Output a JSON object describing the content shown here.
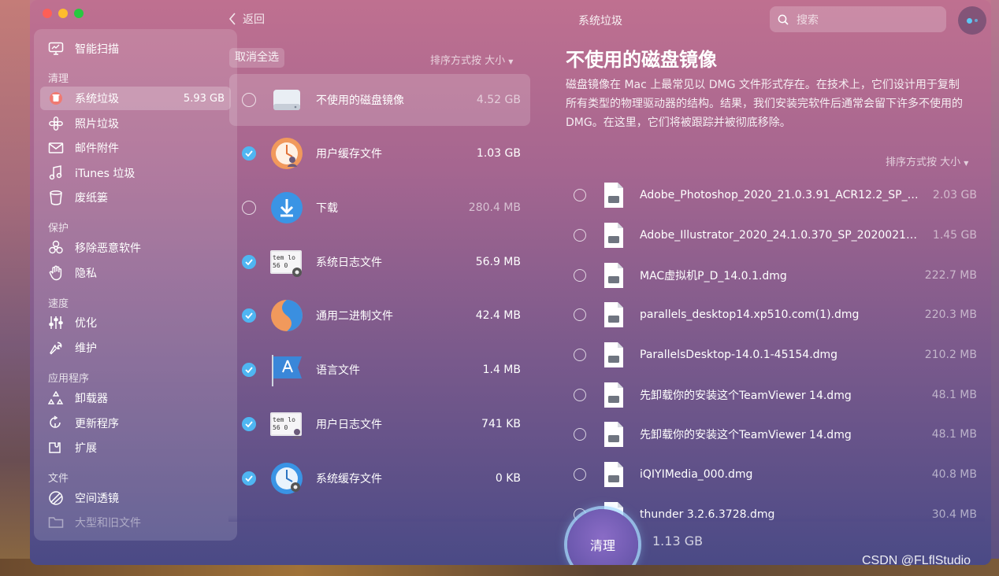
{
  "window": {
    "title": "系统垃圾",
    "back_label": "返回",
    "search_placeholder": "搜索"
  },
  "sidebar": {
    "top_item": {
      "label": "智能扫描",
      "icon": "monitor-icon"
    },
    "sections": [
      {
        "title": "清理",
        "items": [
          {
            "label": "系统垃圾",
            "value": "5.93 GB",
            "active": true,
            "icon": "trash-can-icon"
          },
          {
            "label": "照片垃圾",
            "icon": "flower-icon"
          },
          {
            "label": "邮件附件",
            "icon": "mail-icon"
          },
          {
            "label": "iTunes 垃圾",
            "icon": "music-note-icon"
          },
          {
            "label": "废纸篓",
            "icon": "bin-icon"
          }
        ]
      },
      {
        "title": "保护",
        "items": [
          {
            "label": "移除恶意软件",
            "icon": "biohazard-icon"
          },
          {
            "label": "隐私",
            "icon": "hand-icon"
          }
        ]
      },
      {
        "title": "速度",
        "items": [
          {
            "label": "优化",
            "icon": "sliders-icon"
          },
          {
            "label": "维护",
            "icon": "wrench-icon"
          }
        ]
      },
      {
        "title": "应用程序",
        "items": [
          {
            "label": "卸载器",
            "icon": "uninstaller-icon"
          },
          {
            "label": "更新程序",
            "icon": "update-icon"
          },
          {
            "label": "扩展",
            "icon": "extension-icon"
          }
        ]
      },
      {
        "title": "文件",
        "items": [
          {
            "label": "空间透镜",
            "icon": "lens-icon"
          },
          {
            "label": "大型和旧文件",
            "icon": "folder-icon",
            "dim": true
          }
        ]
      }
    ]
  },
  "list": {
    "deselect_label": "取消全选",
    "sort_label": "排序方式按 大小",
    "items": [
      {
        "name": "不使用的磁盘镜像",
        "size": "4.52 GB",
        "checked": false,
        "selected": true,
        "icon": "disk-image-icon"
      },
      {
        "name": "用户缓存文件",
        "size": "1.03 GB",
        "checked": true,
        "icon": "user-cache-icon"
      },
      {
        "name": "下载",
        "size": "280.4 MB",
        "checked": false,
        "icon": "download-icon"
      },
      {
        "name": "系统日志文件",
        "size": "56.9 MB",
        "checked": true,
        "icon": "system-log-icon"
      },
      {
        "name": "通用二进制文件",
        "size": "42.4 MB",
        "checked": true,
        "icon": "universal-binary-icon"
      },
      {
        "name": "语言文件",
        "size": "1.4 MB",
        "checked": true,
        "icon": "language-files-icon"
      },
      {
        "name": "用户日志文件",
        "size": "741 KB",
        "checked": true,
        "icon": "user-log-icon"
      },
      {
        "name": "系统缓存文件",
        "size": "0 KB",
        "checked": true,
        "icon": "system-cache-icon"
      }
    ]
  },
  "detail": {
    "title": "不使用的磁盘镜像",
    "description": "磁盘镜像在 Mac 上最常见以 DMG 文件形式存在。在技术上，它们设计用于复制所有类型的物理驱动器的结构。结果，我们安装完软件后通常会留下许多不使用的 DMG。在这里，它们将被跟踪并被彻底移除。",
    "sort_label": "排序方式按 大小",
    "files": [
      {
        "name": "Adobe_Photoshop_2020_21.0.3.91_ACR12.2_SP_20...",
        "size": "2.03 GB"
      },
      {
        "name": "Adobe_Illustrator_2020_24.1.0.370_SP_20200215.d...",
        "size": "1.45 GB"
      },
      {
        "name": "MAC虚拟机P_D_14.0.1.dmg",
        "size": "222.7 MB"
      },
      {
        "name": "parallels_desktop14.xp510.com(1).dmg",
        "size": "220.3 MB"
      },
      {
        "name": "ParallelsDesktop-14.0.1-45154.dmg",
        "size": "210.2 MB"
      },
      {
        "name": "先卸载你的安装这个TeamViewer 14.dmg",
        "size": "48.1 MB"
      },
      {
        "name": "先卸载你的安装这个TeamViewer 14.dmg",
        "size": "48.1 MB"
      },
      {
        "name": "iQIYIMedia_000.dmg",
        "size": "40.8 MB"
      },
      {
        "name": "thunder 3.2.6.3728.dmg",
        "size": "30.4 MB"
      }
    ]
  },
  "action": {
    "clean_label": "清理",
    "total_size": "1.13 GB"
  },
  "watermark": "CSDN @FLflStudio"
}
